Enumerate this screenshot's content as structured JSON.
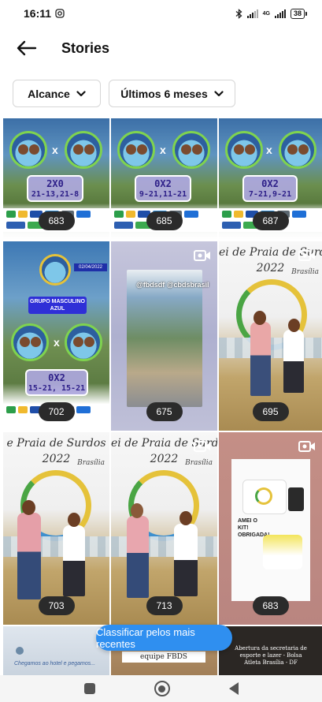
{
  "status_bar": {
    "time": "16:11",
    "network_label": "4G",
    "battery": "38"
  },
  "header": {
    "title": "Stories"
  },
  "filters": {
    "reach_label": "Alcance",
    "period_label": "Últimos 6 meses"
  },
  "stories": [
    {
      "count": "683",
      "score": "2X0",
      "sets": "21-13,21-8"
    },
    {
      "count": "685",
      "score": "0X2",
      "sets": "9-21,11-21"
    },
    {
      "count": "687",
      "score": "0X2",
      "sets": "7-21,9-21"
    },
    {
      "count": "702",
      "score": "0X2",
      "sets": "15-21, 15-21",
      "group": "GRUPO MASCULINO AZUL",
      "date": "02/04/2022"
    },
    {
      "count": "675",
      "caption": "@fbdsdf @cbdsbrasil"
    },
    {
      "count": "695",
      "event_title": "ei de Praia de Surdo",
      "event_year": "2022",
      "city": "Brasília"
    },
    {
      "count": "703",
      "event_title": "e Praia de Surdos",
      "event_year": "2022",
      "city": "Brasília"
    },
    {
      "count": "713",
      "event_title": "ei de Praia de Surdos",
      "event_year": "2022",
      "city": "Brasília"
    },
    {
      "count": "683",
      "kit_text": "AMEI O KIT! OBRIGADA!"
    },
    {
      "caption": "Chegamos ao hotel e pegamos..."
    },
    {
      "caption": "equipe FBDS"
    },
    {
      "caption": "Abertura da secretaria de esporte e lazer - Bolsa Atleta Brasília - DF"
    }
  ],
  "sort_button": "Classificar pelos mais recentes",
  "icons": {
    "back": "arrow-left",
    "chevron": "chevron-down",
    "camera": "video-camera",
    "nav_recents": "square",
    "nav_home": "circle",
    "nav_back": "triangle"
  },
  "colors": {
    "accent": "#2f8ff0",
    "pill": "#2b2b2b"
  }
}
